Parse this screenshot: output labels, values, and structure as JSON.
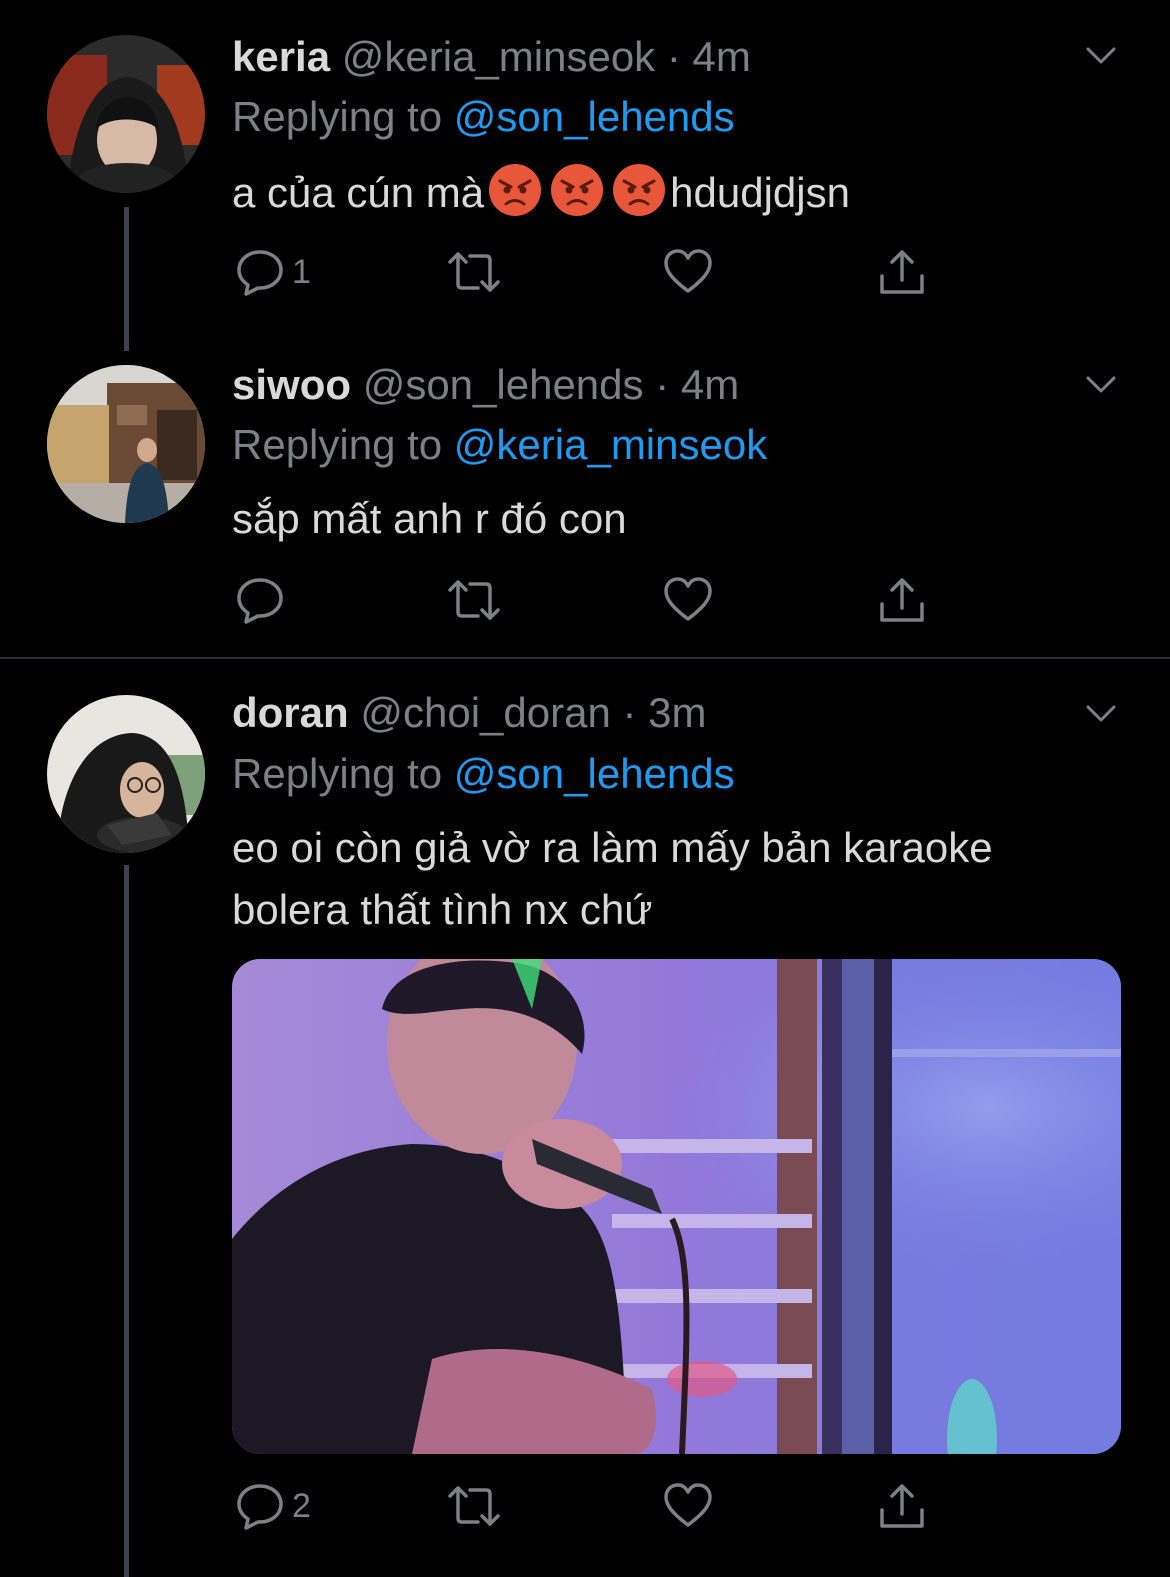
{
  "tweets": [
    {
      "name": "keria",
      "handle": "@keria_minseok",
      "dot": "·",
      "time": "4m",
      "replying_prefix": "Replying to",
      "replying_to": "@son_lehends",
      "text_before": "a của cún mà",
      "emoji": [
        "angry-face-emoji",
        "angry-face-emoji",
        "angry-face-emoji"
      ],
      "text_after": "hdudjdjsn",
      "reply_count": "1"
    },
    {
      "name": "siwoo",
      "handle": "@son_lehends",
      "dot": "·",
      "time": "4m",
      "replying_prefix": "Replying to",
      "replying_to": "@keria_minseok",
      "text": "sắp mất anh r đó con",
      "reply_count": ""
    },
    {
      "name": "doran",
      "handle": "@choi_doran",
      "dot": "·",
      "time": "3m",
      "replying_prefix": "Replying to",
      "replying_to": "@son_lehends",
      "text_line1": "eo oi còn giả vờ ra làm mấy bản karaoke",
      "text_line2": "bolera thất tình nx chứ",
      "reply_count": "2"
    }
  ],
  "colors": {
    "background": "#000000",
    "text": "#d9d9d9",
    "muted": "#7b8186",
    "link": "#1d9bf0",
    "angry_face": "#e8573a"
  }
}
